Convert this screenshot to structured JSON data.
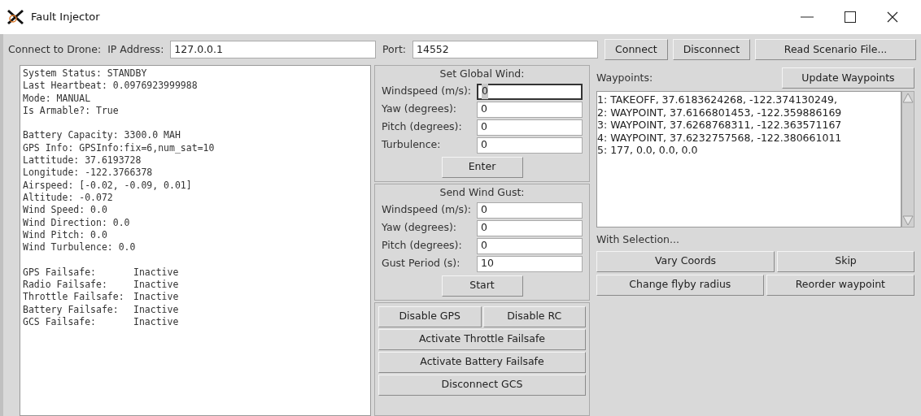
{
  "window": {
    "title": "Fault Injector"
  },
  "connection": {
    "label": "Connect to Drone:",
    "ip_label": "IP Address:",
    "ip_value": "127.0.0.1",
    "port_label": "Port:",
    "port_value": "14552",
    "buttons": [
      "Connect",
      "Disconnect",
      "Read Scenario File..."
    ]
  },
  "status_log": {
    "groups": [
      [
        "System Status: STANDBY",
        "Last Heartbeat: 0.0976923999988",
        "Mode: MANUAL",
        "Is Armable?: True"
      ],
      [
        "Battery Capacity: 3300.0 MAH",
        "GPS Info: GPSInfo:fix=6,num_sat=10",
        "Lattitude: 37.6193728",
        "Longitude: -122.3766378",
        "Airspeed: [-0.02, -0.09, 0.01]",
        "Altitude: -0.072",
        "Wind Speed: 0.0",
        "Wind Direction: 0.0",
        "Wind Pitch: 0.0",
        "Wind Turbulence: 0.0"
      ]
    ],
    "failsafes": [
      {
        "label": "GPS Failsafe:",
        "value": "Inactive"
      },
      {
        "label": "Radio Failsafe:",
        "value": "Inactive"
      },
      {
        "label": "Throttle Failsafe:",
        "value": "Inactive"
      },
      {
        "label": "Battery Failsafe:",
        "value": "Inactive"
      },
      {
        "label": "GCS Failsafe:",
        "value": "Inactive"
      }
    ]
  },
  "global_wind": {
    "title": "Set Global Wind:",
    "fields": [
      {
        "label": "Windspeed (m/s):",
        "value": "0",
        "focused": true
      },
      {
        "label": "Yaw (degrees):",
        "value": "0",
        "focused": false
      },
      {
        "label": "Pitch (degrees):",
        "value": "0",
        "focused": false
      },
      {
        "label": "Turbulence:",
        "value": "0",
        "focused": false
      }
    ],
    "button": "Enter"
  },
  "wind_gust": {
    "title": "Send Wind Gust:",
    "fields": [
      {
        "label": "Windspeed (m/s):",
        "value": "0",
        "focused": false
      },
      {
        "label": "Yaw (degrees):",
        "value": "0",
        "focused": false
      },
      {
        "label": "Pitch (degrees):",
        "value": "0",
        "focused": false
      },
      {
        "label": "Gust Period (s):",
        "value": "10",
        "focused": false
      }
    ],
    "button": "Start"
  },
  "failsafe_buttons": [
    [
      "Disable GPS",
      "Disable RC"
    ],
    [
      "Activate Throttle Failsafe"
    ],
    [
      "Activate Battery Failsafe"
    ],
    [
      "Disconnect GCS"
    ]
  ],
  "waypoints": {
    "label": "Waypoints:",
    "update_button": "Update Waypoints",
    "items": [
      "1: TAKEOFF, 37.6183624268, -122.374130249,",
      "2: WAYPOINT, 37.6166801453, -122.359886169",
      "3: WAYPOINT, 37.6268768311, -122.363571167",
      "4: WAYPOINT, 37.6232757568, -122.380661011",
      "5: 177, 0.0, 0.0, 0.0"
    ],
    "selection_label": "With Selection...",
    "selection_buttons": [
      [
        "Vary Coords",
        "Skip"
      ],
      [
        "Change flyby radius",
        "Reorder waypoint"
      ]
    ]
  }
}
